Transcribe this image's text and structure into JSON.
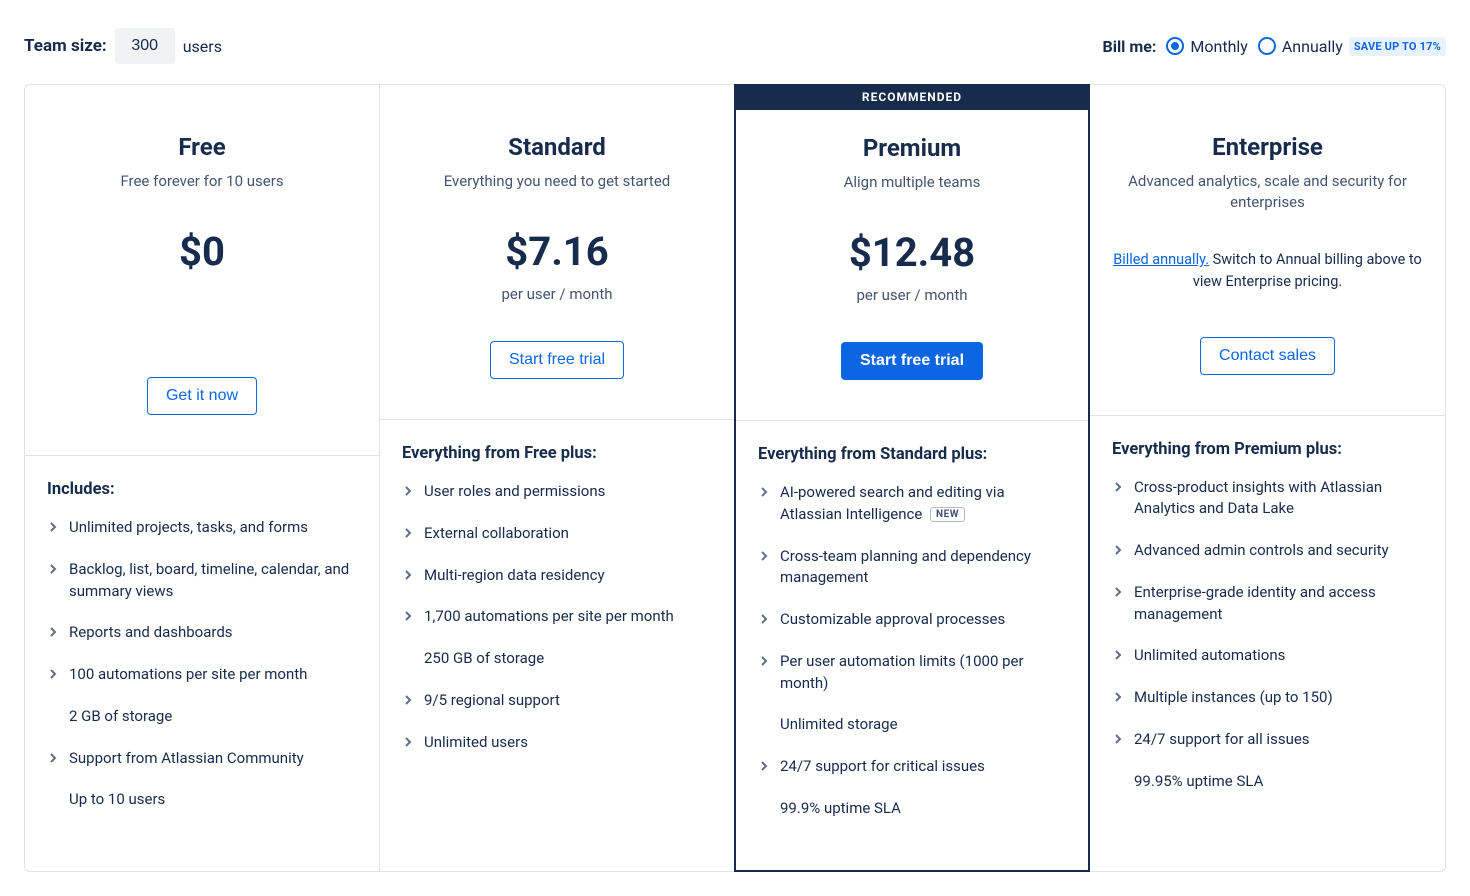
{
  "controls": {
    "team_size_label": "Team size:",
    "team_size_value": "300",
    "users_label": "users",
    "bill_me_label": "Bill me:",
    "monthly_label": "Monthly",
    "annually_label": "Annually",
    "save_badge": "SAVE UP TO 17%"
  },
  "recommended_label": "RECOMMENDED",
  "plans": [
    {
      "name": "Free",
      "tagline": "Free forever for 10 users",
      "price": "$0",
      "price_note": "",
      "cta": "Get it now",
      "cta_primary": false,
      "body_heading": "Includes:",
      "features": [
        {
          "text": "Unlimited projects, tasks, and forms",
          "arrow": true
        },
        {
          "text": "Backlog, list, board, timeline, calendar, and summary views",
          "arrow": true
        },
        {
          "text": "Reports and dashboards",
          "arrow": true
        },
        {
          "text": "100 automations per site per month",
          "arrow": true
        },
        {
          "text": "2 GB of storage",
          "arrow": false
        },
        {
          "text": "Support from Atlassian Community",
          "arrow": true
        },
        {
          "text": "Up to 10 users",
          "arrow": false
        }
      ]
    },
    {
      "name": "Standard",
      "tagline": "Everything you need to get started",
      "price": "$7.16",
      "price_note": "per user / month",
      "cta": "Start free trial",
      "cta_primary": false,
      "body_heading": "Everything from Free plus:",
      "features": [
        {
          "text": "User roles and permissions",
          "arrow": true
        },
        {
          "text": "External collaboration",
          "arrow": true
        },
        {
          "text": "Multi-region data residency",
          "arrow": true
        },
        {
          "text": "1,700 automations per site per month",
          "arrow": true
        },
        {
          "text": "250 GB of storage",
          "arrow": false
        },
        {
          "text": "9/5 regional support",
          "arrow": true
        },
        {
          "text": "Unlimited users",
          "arrow": true
        }
      ]
    },
    {
      "name": "Premium",
      "tagline": "Align multiple teams",
      "price": "$12.48",
      "price_note": "per user / month",
      "cta": "Start free trial",
      "cta_primary": true,
      "recommended": true,
      "body_heading": "Everything from Standard plus:",
      "features": [
        {
          "text": "AI-powered search and editing via Atlassian Intelligence",
          "arrow": true,
          "new": true
        },
        {
          "text": "Cross-team planning and dependency management",
          "arrow": true
        },
        {
          "text": "Customizable approval processes",
          "arrow": true
        },
        {
          "text": "Per user automation limits (1000 per month)",
          "arrow": true
        },
        {
          "text": "Unlimited storage",
          "arrow": false
        },
        {
          "text": "24/7 support for critical issues",
          "arrow": true
        },
        {
          "text": "99.9% uptime SLA",
          "arrow": false
        }
      ]
    },
    {
      "name": "Enterprise",
      "tagline": "Advanced analytics, scale and security for enterprises",
      "enterprise_note_link": "Billed annually.",
      "enterprise_note_rest": " Switch to Annual billing above to view Enterprise pricing.",
      "cta": "Contact sales",
      "cta_primary": false,
      "body_heading": "Everything from Premium plus:",
      "features": [
        {
          "text": "Cross-product insights with Atlassian Analytics and Data Lake",
          "arrow": true
        },
        {
          "text": "Advanced admin controls and security",
          "arrow": true
        },
        {
          "text": "Enterprise-grade identity and access management",
          "arrow": true
        },
        {
          "text": "Unlimited automations",
          "arrow": true
        },
        {
          "text": "Multiple instances (up to 150)",
          "arrow": true
        },
        {
          "text": "24/7 support for all issues",
          "arrow": true
        },
        {
          "text": "99.95% uptime SLA",
          "arrow": false
        }
      ]
    }
  ],
  "new_badge_text": "NEW"
}
